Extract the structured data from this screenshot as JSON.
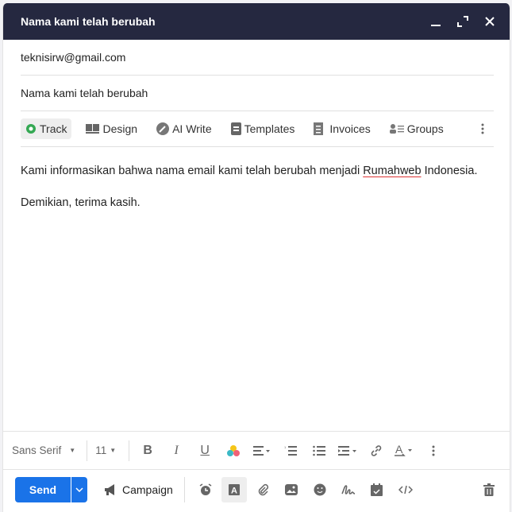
{
  "window": {
    "title": "Nama kami telah berubah"
  },
  "compose": {
    "to": "teknisirw@gmail.com",
    "subject": "Nama kami telah berubah"
  },
  "toolbar": {
    "items": [
      {
        "label": "Track",
        "icon": "eye-icon"
      },
      {
        "label": "Design",
        "icon": "layout-icon"
      },
      {
        "label": "AI Write",
        "icon": "magic-wand-icon"
      },
      {
        "label": "Templates",
        "icon": "template-icon"
      },
      {
        "label": "Invoices",
        "icon": "invoice-icon"
      },
      {
        "label": "Groups",
        "icon": "groups-icon"
      }
    ]
  },
  "message": {
    "line1_before": "Kami informasikan bahwa nama email kami telah berubah menjadi ",
    "line1_misspelled": "Rumahweb",
    "line1_after": " Indonesia.",
    "line2": "Demikian, terima kasih."
  },
  "format": {
    "font": "Sans Serif",
    "size": "11"
  },
  "bottom": {
    "send": "Send",
    "campaign": "Campaign"
  },
  "colors": {
    "header": "#252840",
    "send": "#1a73e8",
    "track": "#34a853"
  }
}
